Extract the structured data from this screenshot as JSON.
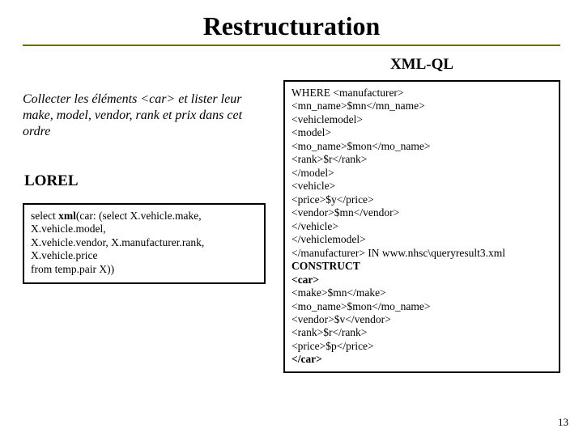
{
  "title": "Restructuration",
  "right_label": "XML-QL",
  "description": "Collecter les éléments <car> et lister leur make, model, vendor, rank et prix dans cet ordre",
  "lorel_label": "LOREL",
  "lorel_code": {
    "prefix": "select ",
    "kw": "xml",
    "lines": [
      "(car: (select X.vehicle.make,",
      "X.vehicle.model,",
      "X.vehicle.vendor, X.manufacturer.rank,",
      "X.vehicle.price",
      "from temp.pair X))"
    ]
  },
  "xmlql_code": [
    {
      "t": "WHERE <manufacturer>"
    },
    {
      "t": "<mn_name>$mn</mn_name>"
    },
    {
      "t": "<vehiclemodel>"
    },
    {
      "t": "<model>"
    },
    {
      "t": "<mo_name>$mon</mo_name>"
    },
    {
      "t": "<rank>$r</rank>"
    },
    {
      "t": "</model>"
    },
    {
      "t": "<vehicle>"
    },
    {
      "t": "<price>$y</price>"
    },
    {
      "t": "<vendor>$mn</vendor>"
    },
    {
      "t": "</vehicle>"
    },
    {
      "t": "</vehiclemodel>"
    },
    {
      "t": "</manufacturer> IN www.nhsc\\queryresult3.xml"
    },
    {
      "t": "CONSTRUCT",
      "b": true
    },
    {
      "t": "<car>",
      "b": true
    },
    {
      "t": "<make>$mn</make>"
    },
    {
      "t": "<mo_name>$mon</mo_name>"
    },
    {
      "t": "<vendor>$v</vendor>"
    },
    {
      "t": "<rank>$r</rank>"
    },
    {
      "t": "<price>$p</price>"
    },
    {
      "t": "</car>",
      "b": true
    }
  ],
  "page_number": "13"
}
